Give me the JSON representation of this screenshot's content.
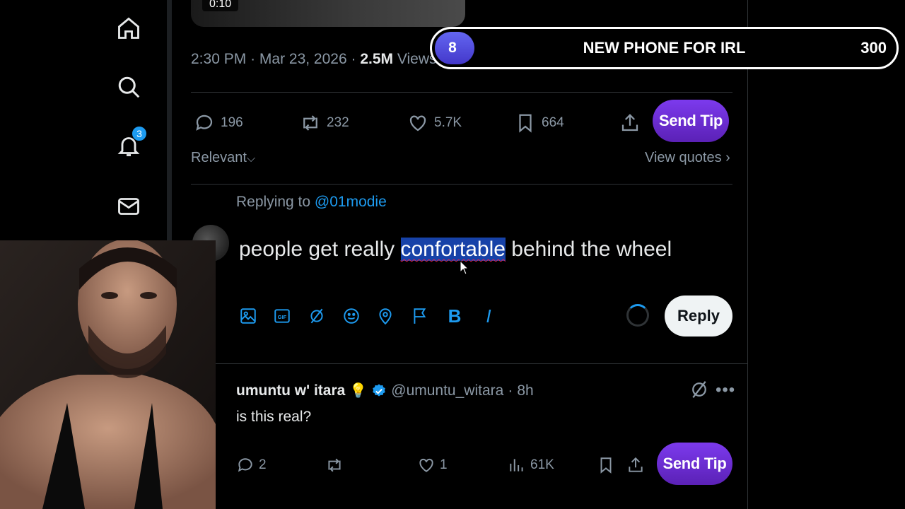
{
  "nav": {
    "notifications_count": "3"
  },
  "post": {
    "video_time": "0:10",
    "time": "2:30 PM",
    "date": "Mar 23, 2026",
    "sep": "·",
    "views_count": "2.5M",
    "views_label": "Views",
    "replies": "196",
    "reposts": "232",
    "likes": "5.7K",
    "bookmarks": "664",
    "send_tip": "Send Tip"
  },
  "sort": {
    "label": "Relevant",
    "view_quotes": "View quotes"
  },
  "compose": {
    "replying_prefix": "Replying to",
    "replying_handle": "@01modie",
    "text_before": "people get really ",
    "text_selected": "confortable",
    "text_after": " behind the wheel",
    "bold_label": "B",
    "italic_label": "I",
    "reply_button": "Reply"
  },
  "reply": {
    "author_name": "umuntu w' itara",
    "author_emoji": "💡",
    "author_handle": "@umuntu_witara",
    "age": "8h",
    "sep": "·",
    "body": "is this real?",
    "replies": "2",
    "reposts": "",
    "likes": "1",
    "views": "61K",
    "send_tip": "Send Tip"
  },
  "goal": {
    "current": "8",
    "title": "NEW PHONE FOR IRL",
    "target": "300",
    "progress_fraction": 0.027
  },
  "colors": {
    "accent": "#1d9bf0",
    "tip_purple": "#6d28d9",
    "muted": "#8b98a5"
  }
}
